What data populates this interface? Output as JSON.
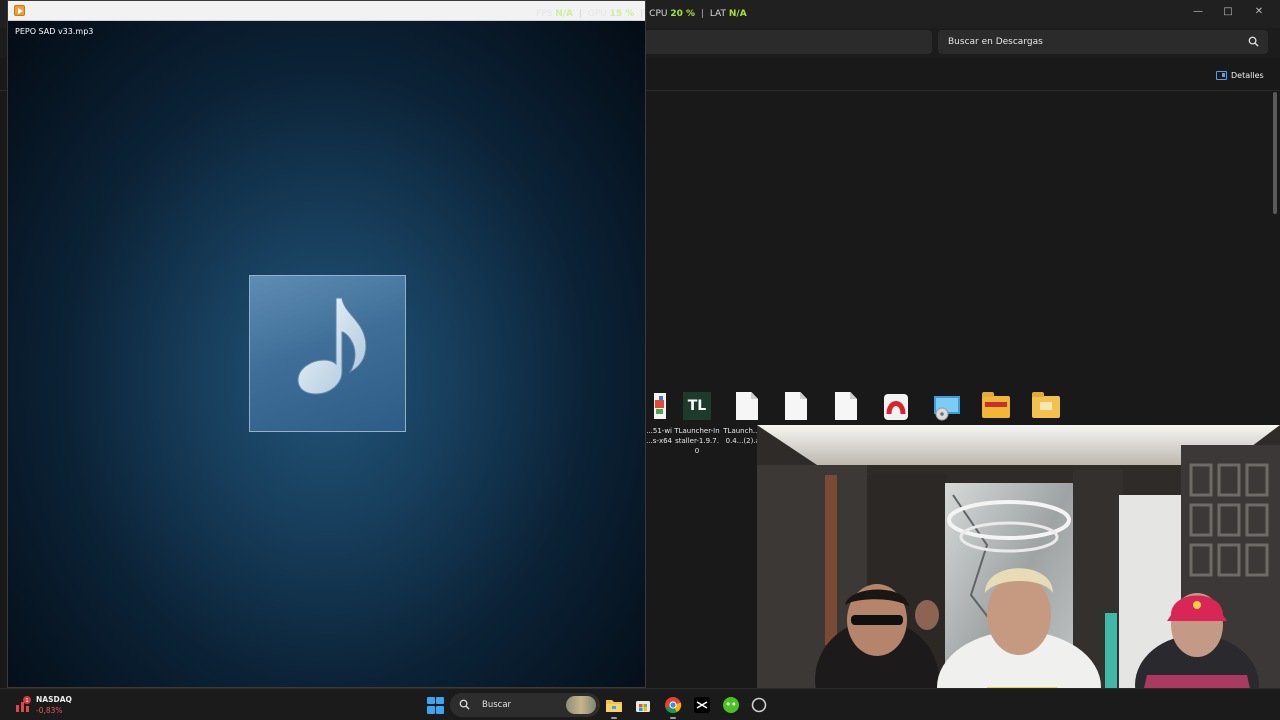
{
  "explorer": {
    "search_placeholder": "Buscar en Descargas",
    "details_label": "Detalles",
    "files": [
      {
        "label": "...51-wi\n...s-x64",
        "icon": "installer-icon"
      },
      {
        "label": "TLauncher-Installer-1.9.7.0",
        "icon": "tlauncher-icon"
      },
      {
        "label": "TLaunch...PE-0.4...(2).apk",
        "icon": "document-icon"
      },
      {
        "label": "",
        "icon": "document-icon"
      },
      {
        "label": "",
        "icon": "document-icon"
      },
      {
        "label": "",
        "icon": "pdf-reader-icon"
      },
      {
        "label": "",
        "icon": "disc-installer-icon"
      },
      {
        "label": "",
        "icon": "folder-icon"
      },
      {
        "label": "",
        "icon": "folder-icon"
      }
    ]
  },
  "player": {
    "filename": "PEPO SAD v33.mp3"
  },
  "perf_overlay": {
    "fps_label": "FPS",
    "fps_value": "N/A",
    "gpu_label": "GPU",
    "gpu_value": "15 %",
    "cpu_label": "CPU",
    "cpu_value": "20 %",
    "lat_label": "LAT",
    "lat_value": "N/A",
    "value_color": "#a6e830"
  },
  "taskbar": {
    "widget_name": "NASDAQ",
    "widget_change": "-0,83%",
    "widget_badge": "1",
    "search_label": "Buscar",
    "accent": "#3ba6f0"
  }
}
